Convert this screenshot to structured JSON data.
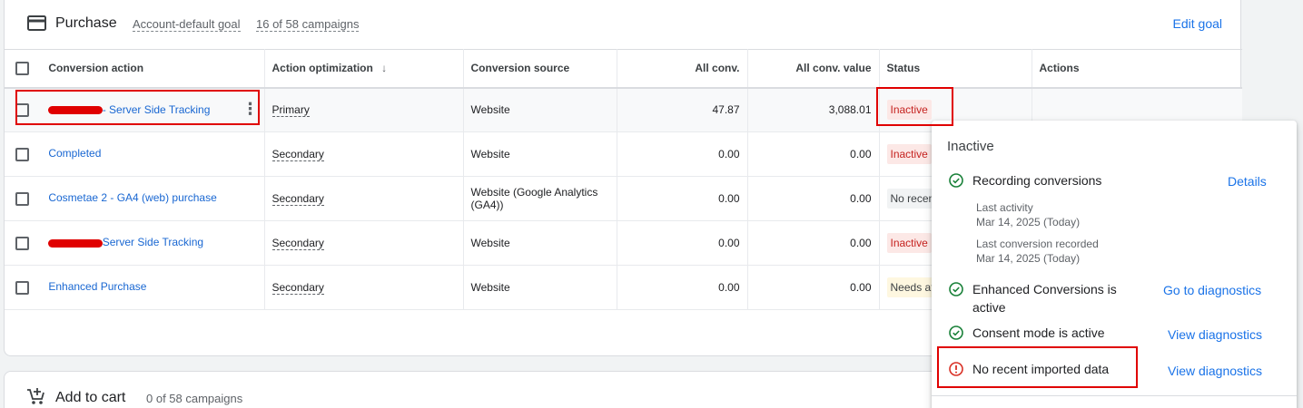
{
  "goal": {
    "title": "Purchase",
    "account_default": "Account-default goal",
    "campaigns": "16 of 58 campaigns",
    "edit_label": "Edit goal"
  },
  "table": {
    "headers": [
      "Conversion action",
      "Action optimization",
      "Conversion source",
      "All conv.",
      "All conv. value",
      "Status",
      "Actions"
    ],
    "rows": [
      {
        "name": "- Server Side Tracking",
        "optimization": "Primary",
        "source": "Website",
        "all_conv": "47.87",
        "all_conv_value": "3,088.01",
        "status": "Inactive"
      },
      {
        "name": "Completed",
        "optimization": "Secondary",
        "source": "Website",
        "all_conv": "0.00",
        "all_conv_value": "0.00",
        "status": "Inactive"
      },
      {
        "name": "Cosmetae 2 - GA4 (web) purchase",
        "optimization": "Secondary",
        "source": "Website (Google Analytics (GA4))",
        "all_conv": "0.00",
        "all_conv_value": "0.00",
        "status": "No recen"
      },
      {
        "name": "Server Side Tracking",
        "optimization": "Secondary",
        "source": "Website",
        "all_conv": "0.00",
        "all_conv_value": "0.00",
        "status": "Inactive"
      },
      {
        "name": "Enhanced Purchase",
        "optimization": "Secondary",
        "source": "Website",
        "all_conv": "0.00",
        "all_conv_value": "0.00",
        "status": "Needs at"
      }
    ]
  },
  "second_goal": {
    "title": "Add to cart",
    "campaigns": "0 of 58 campaigns"
  },
  "popup": {
    "title": "Inactive",
    "recording": {
      "label": "Recording conversions",
      "link": "Details"
    },
    "last_activity_label": "Last activity",
    "last_activity_value": "Mar 14, 2025 (Today)",
    "last_conversion_label": "Last conversion recorded",
    "last_conversion_value": "Mar 14, 2025 (Today)",
    "enhanced": {
      "label_line1": "Enhanced Conversions is",
      "label_line2": "active",
      "link": "Go to diagnostics"
    },
    "consent": {
      "label": "Consent mode is active",
      "link": "View diagnostics"
    },
    "imported": {
      "label": "No recent imported data",
      "link": "View diagnostics"
    }
  },
  "colors": {
    "accent": "#1a73e8",
    "ok": "#188038",
    "error": "#d93025",
    "annotation": "#e00000"
  }
}
